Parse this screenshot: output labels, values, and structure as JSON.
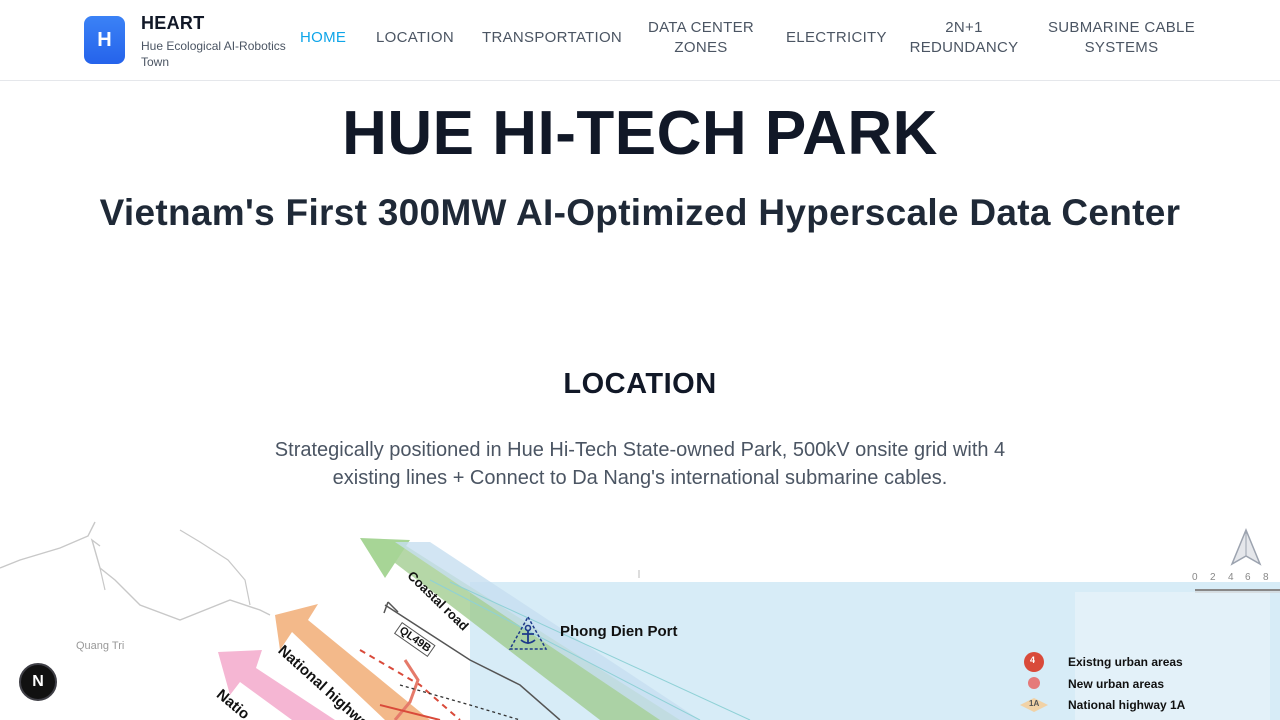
{
  "brand": {
    "logo_letter": "H",
    "title": "HEART",
    "subtitle": "Hue Ecological AI-Robotics Town"
  },
  "nav": {
    "home": "HOME",
    "location": "LOCATION",
    "transportation": "TRANSPORTATION",
    "dc_zones_1": "DATA CENTER",
    "dc_zones_2": "ZONES",
    "electricity": "ELECTRICITY",
    "redundancy_1": "2N+1",
    "redundancy_2": "REDUNDANCY",
    "cable_1": "SUBMARINE CABLE",
    "cable_2": "SYSTEMS",
    "active_color": "#0ea5e9"
  },
  "hero": {
    "title": "HUE HI-TECH PARK",
    "subtitle": "Vietnam's First 300MW AI-Optimized Hyperscale Data Center"
  },
  "location": {
    "title": "LOCATION",
    "description": "Strategically positioned in Hue Hi-Tech State-owned Park, 500kV onsite grid with 4 existing lines + Connect to Da Nang's international submarine cables."
  },
  "map": {
    "coastal_road": "Coastal road",
    "ql49b": "QL49B",
    "port": "Phong Dien Port",
    "quang_tri": "Quang Tri",
    "national_highway_label": "National highway",
    "national_label_short": "Natio",
    "legend": {
      "existing_urban": "Existng urban areas",
      "new_urban": "New urban areas",
      "highway_1a": "National highway 1A",
      "existing_urban_marker": "4",
      "highway_marker": "1A"
    },
    "scale": [
      "0",
      "2",
      "4",
      "6",
      "8"
    ],
    "icons": [
      "compass-icon",
      "anchor-icon"
    ]
  },
  "fab": {
    "label": "N"
  }
}
